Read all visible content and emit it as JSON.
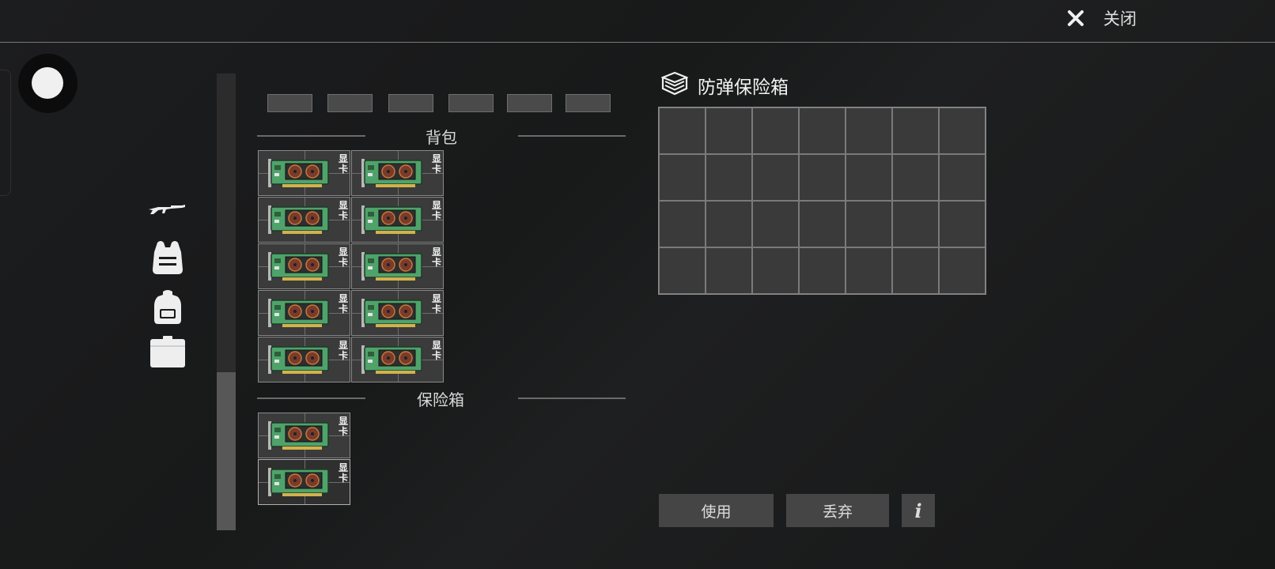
{
  "header": {
    "close_label": "关闭",
    "close_icon": "close-x-icon"
  },
  "sidebar": {
    "icons": [
      "rifle-icon",
      "chest-rig-icon",
      "backpack-icon",
      "safe-case-icon"
    ]
  },
  "quick_slots": [
    "",
    "",
    "",
    "",
    "",
    ""
  ],
  "sections": {
    "backpack": {
      "title": "背包",
      "items": [
        {
          "name": "graphics-card",
          "badge": "显卡"
        },
        {
          "name": "graphics-card",
          "badge": "显卡"
        },
        {
          "name": "graphics-card",
          "badge": "显卡"
        },
        {
          "name": "graphics-card",
          "badge": "显卡"
        },
        {
          "name": "graphics-card",
          "badge": "显卡"
        },
        {
          "name": "graphics-card",
          "badge": "显卡"
        },
        {
          "name": "graphics-card",
          "badge": "显卡"
        },
        {
          "name": "graphics-card",
          "badge": "显卡"
        },
        {
          "name": "graphics-card",
          "badge": "显卡"
        },
        {
          "name": "graphics-card",
          "badge": "显卡"
        }
      ]
    },
    "safe": {
      "title": "保险箱",
      "items": [
        {
          "name": "graphics-card",
          "badge": "显卡"
        },
        {
          "name": "graphics-card",
          "badge": "显卡",
          "selected": true
        }
      ]
    }
  },
  "container": {
    "title": "防弹保险箱",
    "icon": "stacked-box-icon",
    "columns": 7,
    "rows": 4
  },
  "actions": {
    "use_label": "使用",
    "discard_label": "丢弃",
    "info_label": "i"
  },
  "colors": {
    "background": "#1a1b1c",
    "cell": "#3a3a3a",
    "button": "#454545",
    "pcb_green": "#4fa36a"
  }
}
